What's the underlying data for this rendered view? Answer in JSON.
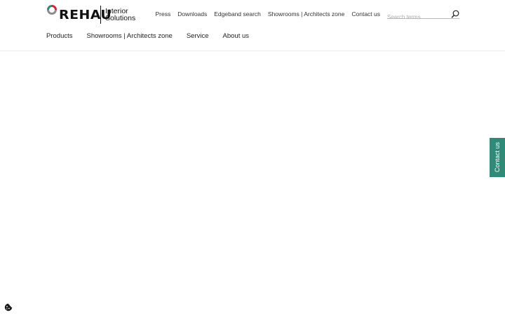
{
  "logo": {
    "brand": "REHAU",
    "sub_line1": "Interior",
    "sub_line2": "Solutions",
    "colors": {
      "red": "#d8213b",
      "green": "#2f8a78",
      "grey": "#8c8c8c"
    }
  },
  "top_nav": {
    "items": [
      {
        "label": "Press"
      },
      {
        "label": "Downloads"
      },
      {
        "label": "Edgeband search"
      },
      {
        "label": "Showrooms | Architects zone"
      },
      {
        "label": "Contact us"
      }
    ]
  },
  "search": {
    "placeholder": "Search terms...",
    "icon": "search-icon"
  },
  "main_nav": {
    "items": [
      {
        "label": "Products"
      },
      {
        "label": "Showrooms | Architects zone"
      },
      {
        "label": "Service"
      },
      {
        "label": "About us"
      }
    ]
  },
  "side_tab": {
    "label": "Contact us",
    "color": "#2f8a78"
  },
  "cookie": {
    "icon": "cookie-icon"
  }
}
